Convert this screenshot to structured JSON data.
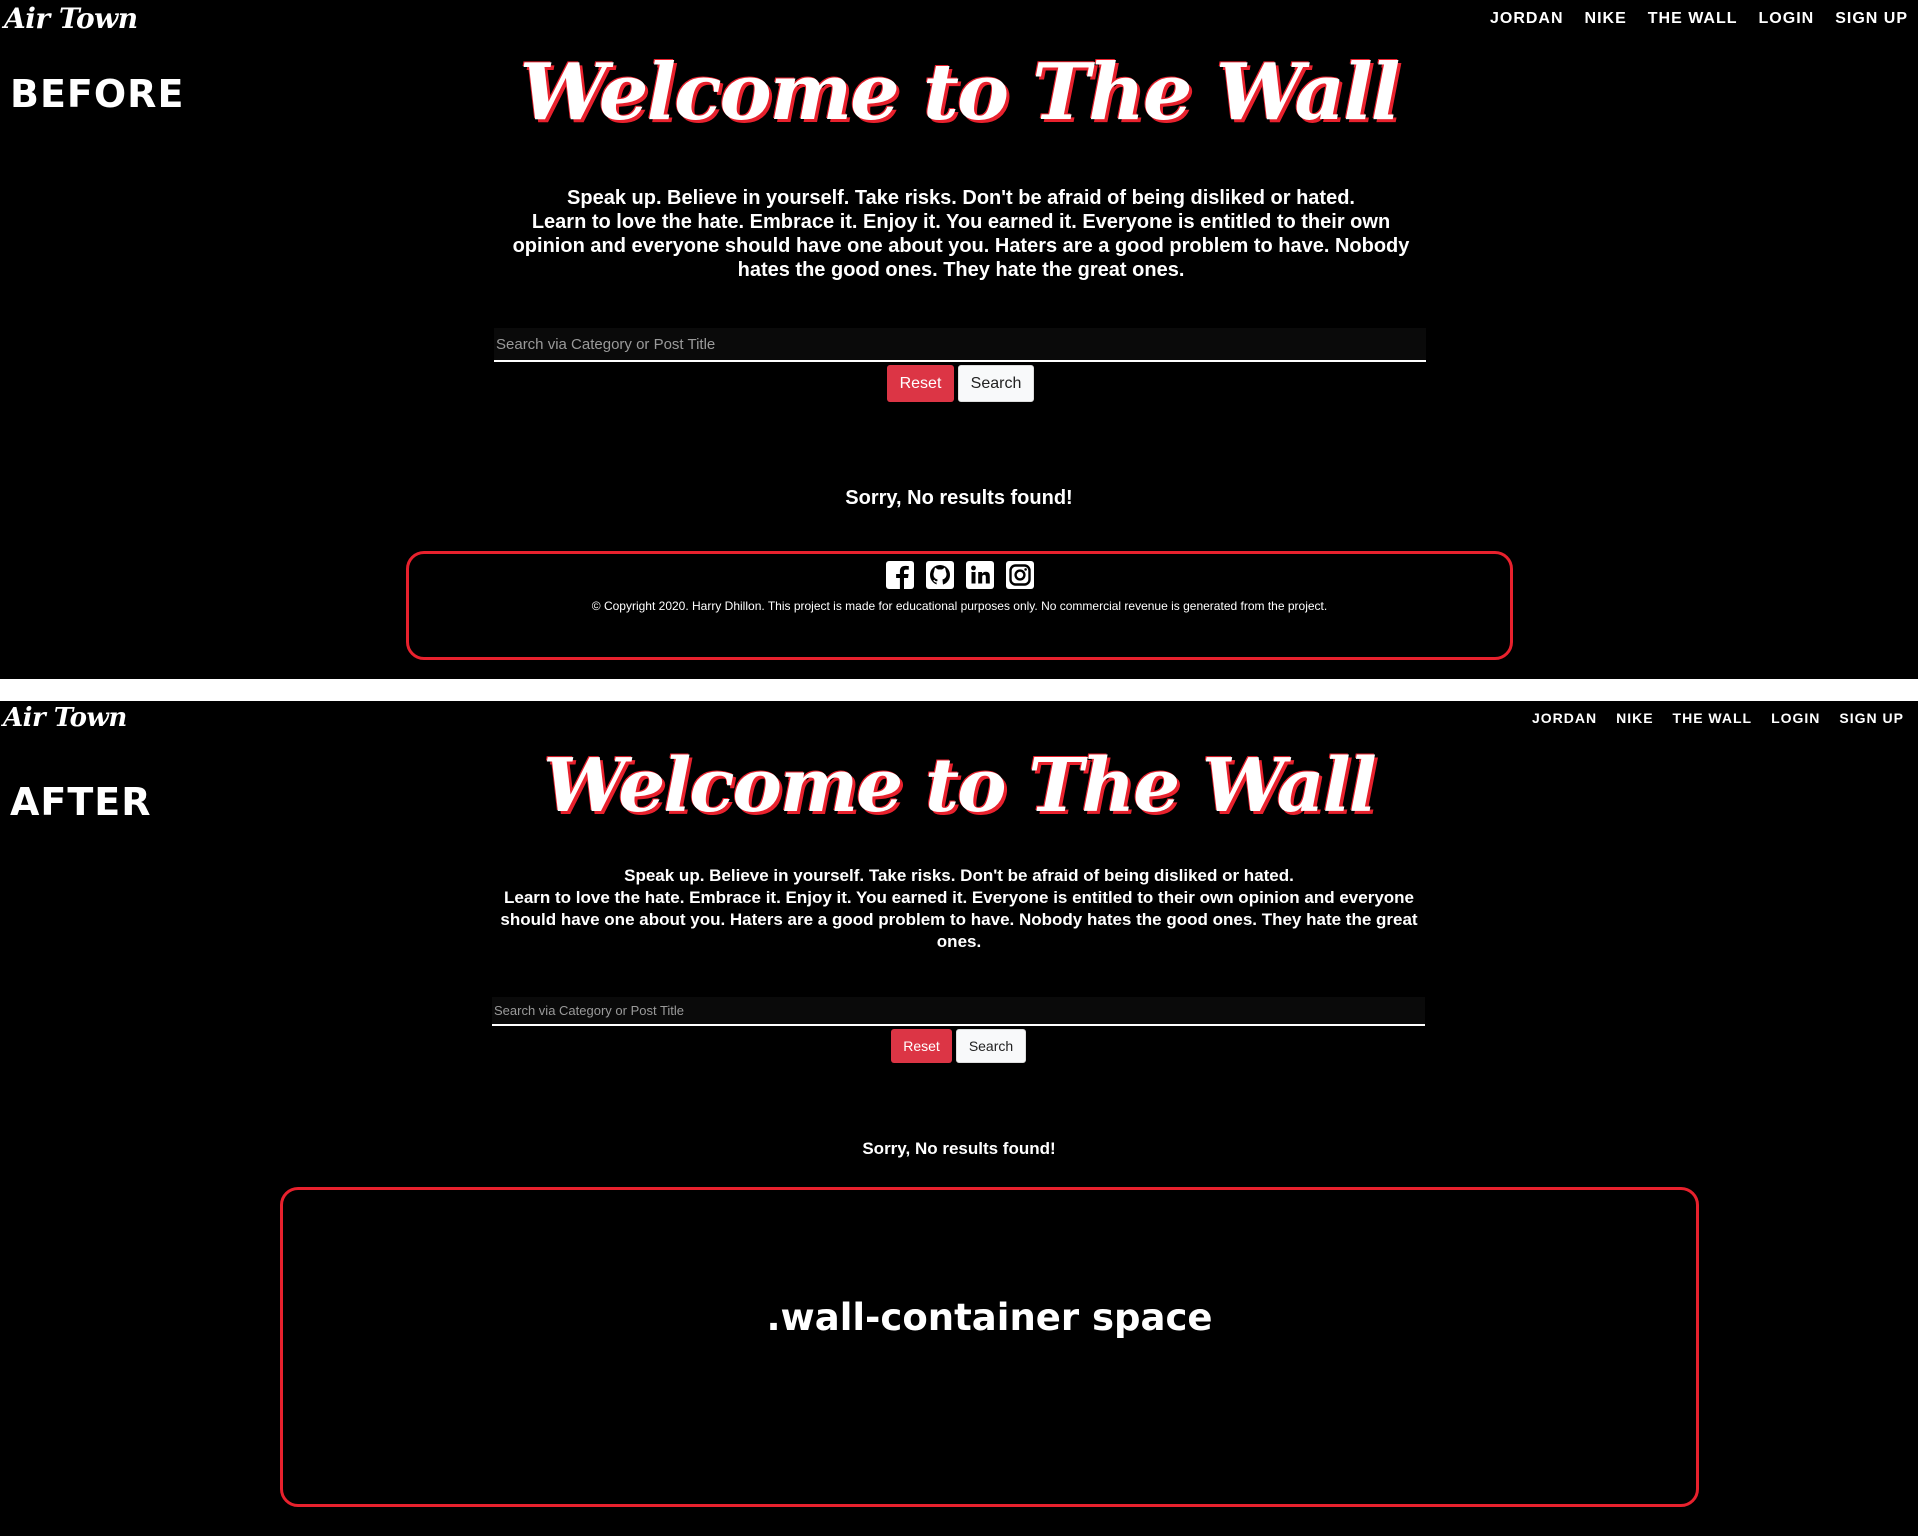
{
  "before": {
    "brand": "Air Town",
    "nav": [
      "JORDAN",
      "NIKE",
      "THE WALL",
      "LOGIN",
      "SIGN UP"
    ],
    "tag": "BEFORE",
    "hero_title": "Welcome to The Wall",
    "quote_line1": "Speak up. Believe in yourself. Take risks. Don't be afraid of being disliked or hated.",
    "quote_line2": "Learn to love the hate. Embrace it. Enjoy it. You earned it. Everyone is entitled to their own opinion and everyone should have one about you. Haters are a good problem to have. Nobody hates the good ones. They hate the great ones.",
    "search_placeholder": "Search via Category or Post Title",
    "reset_label": "Reset",
    "search_label": "Search",
    "no_results": "Sorry, No results found!",
    "social_icons": [
      "facebook-icon",
      "github-icon",
      "linkedin-icon",
      "instagram-icon"
    ],
    "copyright": "© Copyright 2020. Harry Dhillon. This project is made for educational purposes only. No commercial revenue is generated from the project."
  },
  "after": {
    "brand": "Air Town",
    "nav": [
      "JORDAN",
      "NIKE",
      "THE WALL",
      "LOGIN",
      "SIGN UP"
    ],
    "tag": "AFTER",
    "hero_title": "Welcome to The Wall",
    "quote_line1": "Speak up. Believe in yourself. Take risks. Don't be afraid of being disliked or hated.",
    "quote_line2": "Learn to love the hate. Embrace it. Enjoy it. You earned it. Everyone is entitled to their own opinion and everyone should have one about you. Haters are a good problem to have. Nobody hates the good ones. They hate the great ones.",
    "search_placeholder": "Search via Category or Post Title",
    "reset_label": "Reset",
    "search_label": "Search",
    "no_results": "Sorry, No results found!",
    "container_label": ".wall-container space"
  },
  "colors": {
    "background": "#000000",
    "accent_red": "#e8212d",
    "reset_red": "#dc3545",
    "separator": "#ffffff"
  }
}
